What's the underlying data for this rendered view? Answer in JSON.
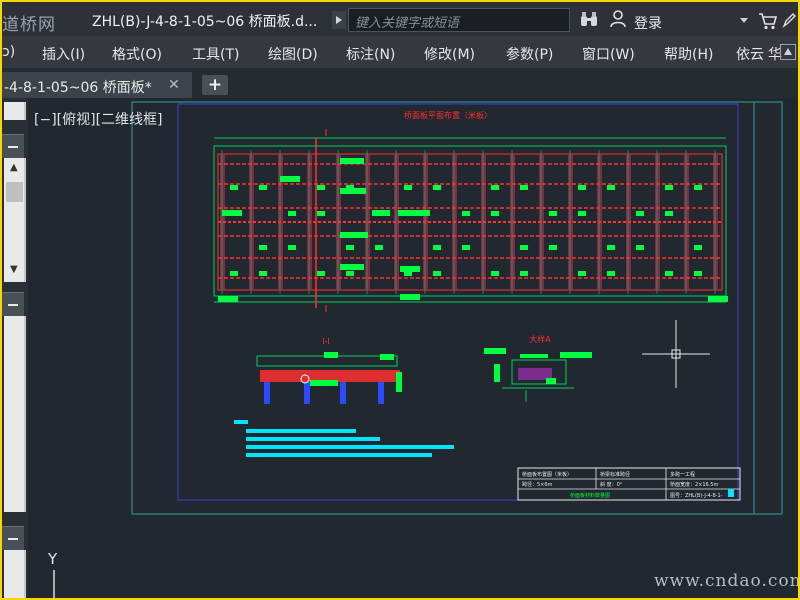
{
  "app": {
    "logo_text": "道桥网",
    "document_title": "ZHL(B)-J-4-8-1-05~06 桥面板.d...",
    "search_placeholder": "键入关键字或短语",
    "login_label": "登录"
  },
  "menu": {
    "edge_label": "ɔ)",
    "items": [
      "插入(I)",
      "格式(O)",
      "工具(T)",
      "绘图(D)",
      "标注(N)",
      "修改(M)",
      "参数(P)",
      "窗口(W)",
      "帮助(H)",
      "依云",
      "华"
    ]
  },
  "tabs": {
    "active_label": "-4-8-1-05~06 桥面板*",
    "close_glyph": "✕",
    "new_tab_glyph": "+"
  },
  "palette": {
    "collapse_glyph": "−"
  },
  "canvas": {
    "view_label": "[−][俯视][二维线框]",
    "y_axis_label": "Y",
    "watermark": "www.cndao.com"
  },
  "drawing": {
    "plan_title": "桥面板平面布置（米板）",
    "section_mark_top": "I",
    "section_mark_bottom": "I",
    "section_title": "I-I",
    "detail_title": "大样A",
    "title_block": {
      "r1c1": "桥面板布置图（米板）",
      "r1c2": "桥梁标准跨径",
      "r1c3": "多跨一工程",
      "r2c1": "跨径：5×6m",
      "r2c2": "斜 度：0°",
      "r2c3": "桥面宽度：2×16.5m",
      "r3c1": "桥面板材料数量图",
      "r3c2": "图号：ZHL(B)-J-4-8-1-"
    }
  },
  "colors": {
    "canvas_background": "#212830",
    "title_bar": "#2e3238",
    "menu_bar": "#35393f",
    "frame_border": "#f5d800"
  }
}
